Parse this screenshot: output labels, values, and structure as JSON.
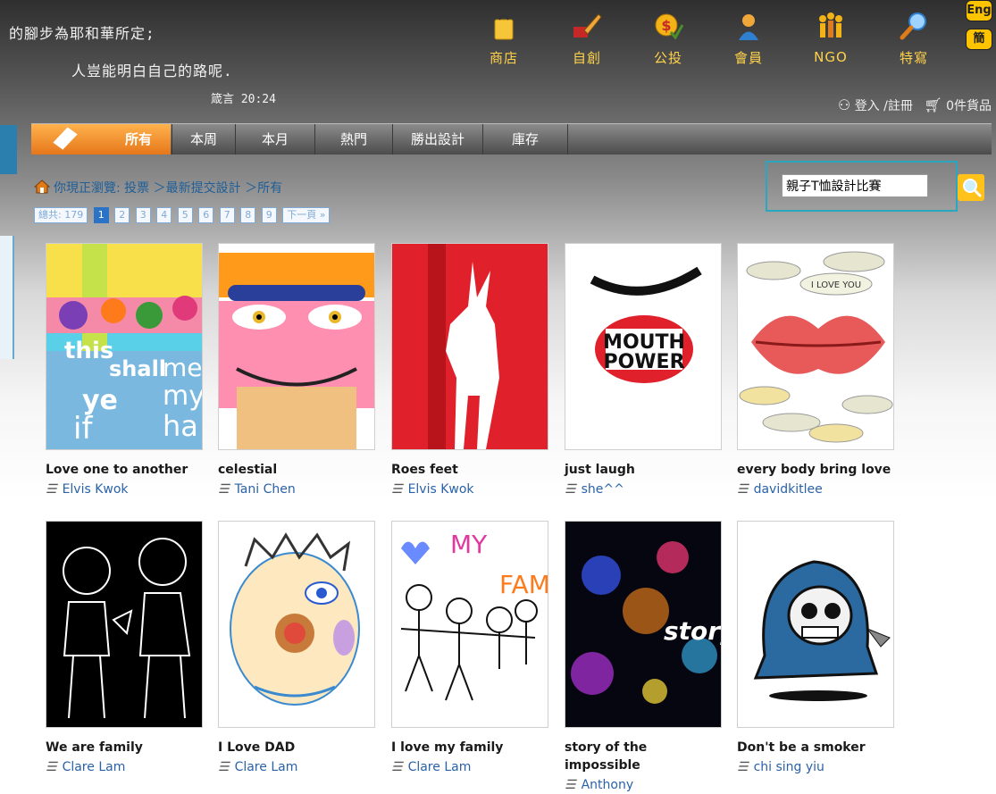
{
  "header": {
    "verse_line1": "的腳步為耶和華所定;",
    "verse_line2": "人豈能明白自己的路呢.",
    "verse_ref": "箴言 20:24"
  },
  "nav": [
    {
      "label": "商店",
      "icon": "shopping-bag-icon"
    },
    {
      "label": "自創",
      "icon": "paint-brush-icon"
    },
    {
      "label": "公投",
      "icon": "vote-coin-icon"
    },
    {
      "label": "會員",
      "icon": "member-icon"
    },
    {
      "label": "NGO",
      "icon": "ngo-people-icon"
    },
    {
      "label": "特寫",
      "icon": "magnifier-icon"
    }
  ],
  "lang": {
    "eng": "Eng",
    "simplified": "簡"
  },
  "account": {
    "login": "登入",
    "separator": " /",
    "register": "註冊",
    "cart": "0件貨品"
  },
  "tabs": [
    "所有",
    "本周",
    "本月",
    "熱門",
    "勝出設計",
    "庫存"
  ],
  "breadcrumb": {
    "text": "你現正瀏覽: 投票 ＞最新提交設計 ＞所有"
  },
  "pagination": {
    "total": "總共: 179",
    "pages": [
      "1",
      "2",
      "3",
      "4",
      "5",
      "6",
      "7",
      "8",
      "9"
    ],
    "next": "下一頁 »",
    "current": "1"
  },
  "search": {
    "value": "親子T恤設計比賽"
  },
  "colors": {
    "accent_orange": "#e6771a",
    "link_blue": "#2a62a8",
    "search_border": "#2aa7c0"
  },
  "designs": [
    {
      "title": "Love one to another",
      "author": "Elvis Kwok"
    },
    {
      "title": "celestial",
      "author": "Tani Chen"
    },
    {
      "title": "Roes feet",
      "author": "Elvis Kwok"
    },
    {
      "title": "just laugh",
      "author": "she^^"
    },
    {
      "title": "every body bring love",
      "author": "davidkitlee"
    },
    {
      "title": "We are family",
      "author": "Clare Lam"
    },
    {
      "title": "I Love DAD",
      "author": "Clare Lam"
    },
    {
      "title": "I love my family",
      "author": "Clare Lam"
    },
    {
      "title": "story of the impossible",
      "author": "Anthony"
    },
    {
      "title": "Don't be a smoker",
      "author": "chi sing yiu"
    }
  ],
  "thumb_text": {
    "mouth_power_1": "MOUTH",
    "mouth_power_2": "POWER",
    "story": "story",
    "i_love_you": "I LOVE YOU",
    "drawing_my": "MY",
    "drawing_fam": "FAM",
    "love_words": "this shall me ye my if ha"
  }
}
